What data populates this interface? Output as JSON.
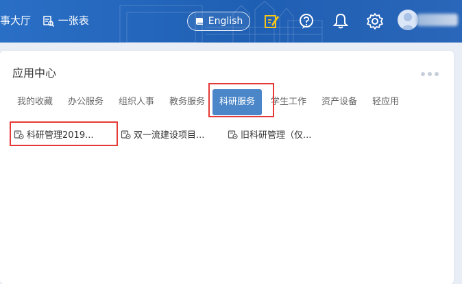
{
  "header": {
    "hall_label": "事大厅",
    "form_label": "一张表",
    "lang_button": "English",
    "colors": {
      "bar": "#1f5fb3",
      "accent": "#f5c518"
    },
    "icons": [
      "form-icon",
      "book-icon",
      "edit-icon",
      "help-icon",
      "bell-icon",
      "gear-icon",
      "avatar-icon"
    ]
  },
  "app_center": {
    "title": "应用中心",
    "tabs": [
      "我的收藏",
      "办公服务",
      "组织人事",
      "教务服务",
      "科研服务",
      "学生工作",
      "资产设备",
      "轻应用"
    ],
    "active_tab": "科研服务",
    "apps": [
      {
        "label": "科研管理2019...",
        "icon": "app-icon"
      },
      {
        "label": "双一流建设项目...",
        "icon": "app-icon"
      },
      {
        "label": "旧科研管理（仅...",
        "icon": "app-icon"
      }
    ],
    "colors": {
      "active_tab": "#4a86c8",
      "highlight": "#e53935"
    }
  }
}
